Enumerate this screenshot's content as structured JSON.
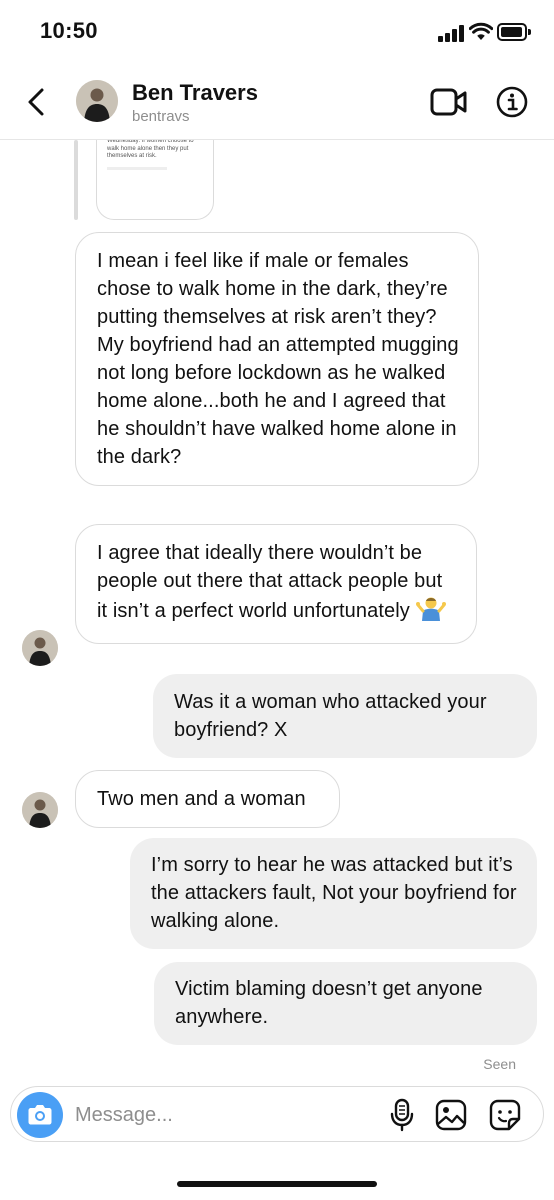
{
  "status_bar": {
    "time": "10:50"
  },
  "header": {
    "name": "Ben Travers",
    "username": "bentravs"
  },
  "shared_post": {
    "snippet": "Wednesday: if women choose to walk home alone then they put themselves at risk."
  },
  "messages": [
    {
      "direction": "incoming",
      "text": "I mean i feel like if male or females chose to walk home in the dark, they’re putting themselves at risk aren’t they?  My boyfriend had an attempted mugging not long before lockdown as he walked home alone...both he and I agreed that he shouldn’t have walked home alone in the dark?"
    },
    {
      "direction": "incoming",
      "text": "I agree that ideally there wouldn’t be people out there that attack people but it isn’t a perfect world unfortunately",
      "emoji": "🤷‍♂️"
    },
    {
      "direction": "outgoing",
      "text": "Was it a woman who attacked your boyfriend? X"
    },
    {
      "direction": "incoming",
      "text": "Two men and a woman"
    },
    {
      "direction": "outgoing",
      "text": "I’m sorry to hear he was attacked but it’s the attackers fault, Not your boyfriend for walking alone."
    },
    {
      "direction": "outgoing",
      "text": "Victim blaming doesn’t get anyone anywhere."
    }
  ],
  "seen_label": "Seen",
  "composer": {
    "placeholder": "Message..."
  },
  "icons": {
    "back": "chevron-left-icon",
    "video": "video-camera-icon",
    "info": "info-icon",
    "camera": "camera-icon",
    "mic": "microphone-icon",
    "gallery": "image-icon",
    "sticker": "sticker-icon"
  },
  "colors": {
    "accent_blue": "#4a9ff5",
    "outgoing_bubble": "#efefef",
    "incoming_border": "#dbdbdb",
    "secondary_text": "#8e8e8e"
  }
}
